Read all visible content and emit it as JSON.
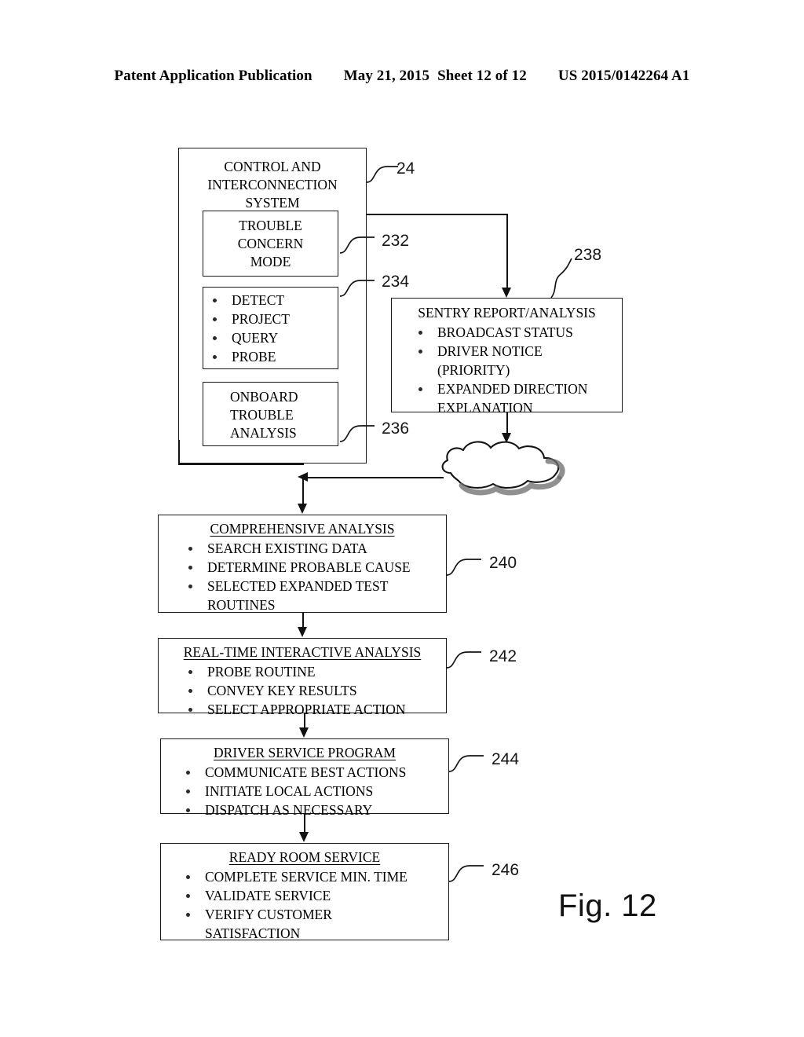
{
  "header": {
    "publication": "Patent Application Publication",
    "date": "May 21, 2015",
    "sheet": "Sheet 12 of 12",
    "pub_number": "US 2015/0142264 A1"
  },
  "figure": {
    "caption": "Fig. 12",
    "boxes": {
      "control_system": {
        "title": "CONTROL AND\nINTERCONNECTION\nSYSTEM",
        "ref": "24"
      },
      "trouble_concern_mode": {
        "title": "TROUBLE\nCONCERN\nMODE",
        "ref": "232"
      },
      "detect_list": {
        "ref": "234",
        "items": [
          "DETECT",
          "PROJECT",
          "QUERY",
          "PROBE"
        ]
      },
      "onboard_trouble_analysis": {
        "title": "ONBOARD\nTROUBLE\nANALYSIS",
        "ref": "236"
      },
      "sentry_report": {
        "title": "SENTRY REPORT/ANALYSIS",
        "ref": "238",
        "items": [
          "BROADCAST STATUS",
          "DRIVER NOTICE",
          "(PRIORITY)",
          "EXPANDED DIRECTION",
          "EXPLANATION"
        ]
      },
      "comprehensive_analysis": {
        "title": "COMPREHENSIVE ANALYSIS",
        "ref": "240",
        "items": [
          "SEARCH EXISTING DATA",
          "DETERMINE PROBABLE CAUSE",
          "SELECTED EXPANDED TEST",
          "ROUTINES"
        ]
      },
      "realtime_analysis": {
        "title": "REAL-TIME INTERACTIVE ANALYSIS",
        "ref": "242",
        "items": [
          "PROBE ROUTINE",
          "CONVEY KEY RESULTS",
          "SELECT APPROPRIATE ACTION"
        ]
      },
      "driver_service_program": {
        "title": "DRIVER SERVICE PROGRAM",
        "ref": "244",
        "items": [
          "COMMUNICATE BEST ACTIONS",
          "INITIATE LOCAL ACTIONS",
          "DISPATCH AS NECESSARY"
        ]
      },
      "ready_room_service": {
        "title": "READY ROOM SERVICE",
        "ref": "246",
        "items": [
          "COMPLETE SERVICE MIN. TIME",
          "VALIDATE SERVICE",
          "VERIFY CUSTOMER",
          "SATISFACTION"
        ]
      },
      "network_cloud": {
        "name": "network-cloud"
      }
    }
  }
}
